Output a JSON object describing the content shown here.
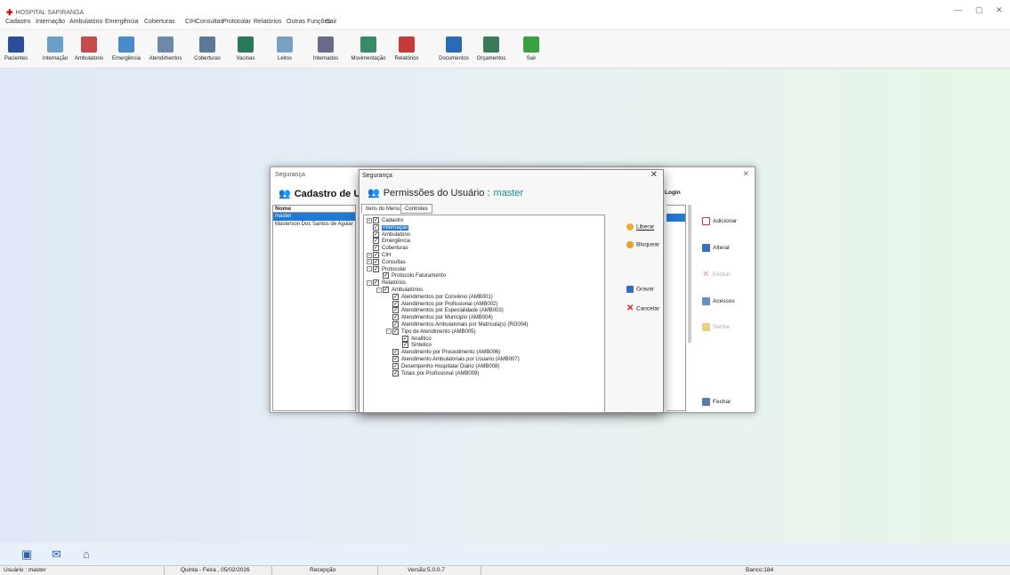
{
  "app": {
    "title": "HOSPITAL SAPIRANGA",
    "minimize": "—",
    "maximize": "▢",
    "close": "✕"
  },
  "menu": [
    "Cadastro",
    "Internação",
    "Ambulatório",
    "Emergência",
    "Coberturas",
    "CIH",
    "Consultas",
    "Protocolar",
    "Relatórios",
    "Outras Funções",
    "Sair"
  ],
  "toolbar": [
    {
      "label": "Pacientes",
      "icon": "patients-icon",
      "color": "#2b4f9e"
    },
    {
      "label": "Internação",
      "icon": "bed-icon",
      "color": "#6aa0c8"
    },
    {
      "label": "Ambulatorio",
      "icon": "ambulatory-icon",
      "color": "#c84a4a"
    },
    {
      "label": "Emergência",
      "icon": "emergency-icon",
      "color": "#4a8ac8"
    },
    {
      "label": "Atendimentos",
      "icon": "appointments-icon",
      "color": "#6a8aa8"
    },
    {
      "label": "Coberturas",
      "icon": "coverage-icon",
      "color": "#5a7a98"
    },
    {
      "label": "Vacinas",
      "icon": "vaccine-icon",
      "color": "#2a7a5a"
    },
    {
      "label": "Leitos",
      "icon": "hospital-bed-icon",
      "color": "#7aa0c0"
    },
    {
      "label": "Internados",
      "icon": "inpatients-icon",
      "color": "#6a6a8a"
    },
    {
      "label": "Movimentação",
      "icon": "movement-icon",
      "color": "#3a8a6a"
    },
    {
      "label": "Relatórios",
      "icon": "reports-icon",
      "color": "#c83a3a"
    },
    {
      "label": "Documentos",
      "icon": "documents-icon",
      "color": "#2a6ab8"
    },
    {
      "label": "Orçamentos",
      "icon": "budget-icon",
      "color": "#3a7a5a"
    },
    {
      "label": "Sair",
      "icon": "exit-icon",
      "color": "#3aa040"
    }
  ],
  "back_window": {
    "title": "Segurança",
    "close": "✕",
    "heading": "Cadastro de U:",
    "col_nome": "Nome",
    "col_login": "Login",
    "rows": [
      "master",
      "Masterson Dos Santos de Aguiar"
    ],
    "buttons": {
      "adicionar": "Adicionar",
      "alterar": "Alterar",
      "excluir": "Excluir",
      "acessos": "Acessos",
      "senha": "Senha",
      "fechar": "Fechar"
    }
  },
  "dialog": {
    "title": "Segurança",
    "close": "✕",
    "heading": "Permissões do Usuário :",
    "user": "master",
    "tabs": [
      "Itens do Menu",
      "Controles"
    ],
    "buttons": {
      "liberar": "Liberar",
      "bloquear": "Bloquear",
      "gravar": "Gravar",
      "cancelar": "Cancelar"
    },
    "tree": [
      {
        "label": "Cadastro",
        "level": 0,
        "exp": "+",
        "checked": true
      },
      {
        "label": "Internação",
        "level": 0,
        "exp": "",
        "checked": true,
        "hl": true
      },
      {
        "label": "Ambulatório",
        "level": 0,
        "exp": "",
        "checked": true
      },
      {
        "label": "Emergência",
        "level": 0,
        "exp": "",
        "checked": true
      },
      {
        "label": "Coberturas",
        "level": 0,
        "exp": "",
        "checked": true
      },
      {
        "label": "CIH",
        "level": 0,
        "exp": "+",
        "checked": true
      },
      {
        "label": "Consultas",
        "level": 0,
        "exp": "+",
        "checked": true
      },
      {
        "label": "Protocolar",
        "level": 0,
        "exp": "-",
        "checked": true
      },
      {
        "label": "Protocolo Faturamento",
        "level": 1,
        "exp": "",
        "checked": true
      },
      {
        "label": "Relatórios",
        "level": 0,
        "exp": "-",
        "checked": true
      },
      {
        "label": "Ambulatórios",
        "level": 1,
        "exp": "-",
        "checked": true
      },
      {
        "label": "Atendimentos por Convênio (AMB001)",
        "level": 2,
        "exp": "",
        "checked": true
      },
      {
        "label": "Atendimentos por Profissional (AMB002)",
        "level": 2,
        "exp": "",
        "checked": true
      },
      {
        "label": "Atendimentos por Especialidade (AMB003)",
        "level": 2,
        "exp": "",
        "checked": true
      },
      {
        "label": "Atendimentos por Municipio (AMB004)",
        "level": 2,
        "exp": "",
        "checked": true
      },
      {
        "label": "Atendimentos Ambulatoriais por Matricula(s) (RG004)",
        "level": 2,
        "exp": "",
        "checked": true
      },
      {
        "label": "Tipo de Atendimento (AMB005)",
        "level": 2,
        "exp": "-",
        "checked": true
      },
      {
        "label": "Analitico",
        "level": 3,
        "exp": "",
        "checked": true
      },
      {
        "label": "Sintetico",
        "level": 3,
        "exp": "",
        "checked": true
      },
      {
        "label": "Atendimento por Procedimento (AMB006)",
        "level": 2,
        "exp": "",
        "checked": true
      },
      {
        "label": "Atendimento Ambulatoriais por Usuario (AMB007)",
        "level": 2,
        "exp": "",
        "checked": true
      },
      {
        "label": "Desempenho Hospitalar Diário (AMB008)",
        "level": 2,
        "exp": "",
        "checked": true
      },
      {
        "label": "Totais por Profissional (AMB009)",
        "level": 2,
        "exp": "",
        "checked": true
      }
    ]
  },
  "bottom_icons": [
    "wa-icon",
    "mail-icon",
    "gift-icon"
  ],
  "status": {
    "user": "Usuário : master",
    "date": "Quinta - Feira , 05/02/2026",
    "sector": "Recepção",
    "version": "Versão:5.0.0.7",
    "db": "Banco:184"
  }
}
